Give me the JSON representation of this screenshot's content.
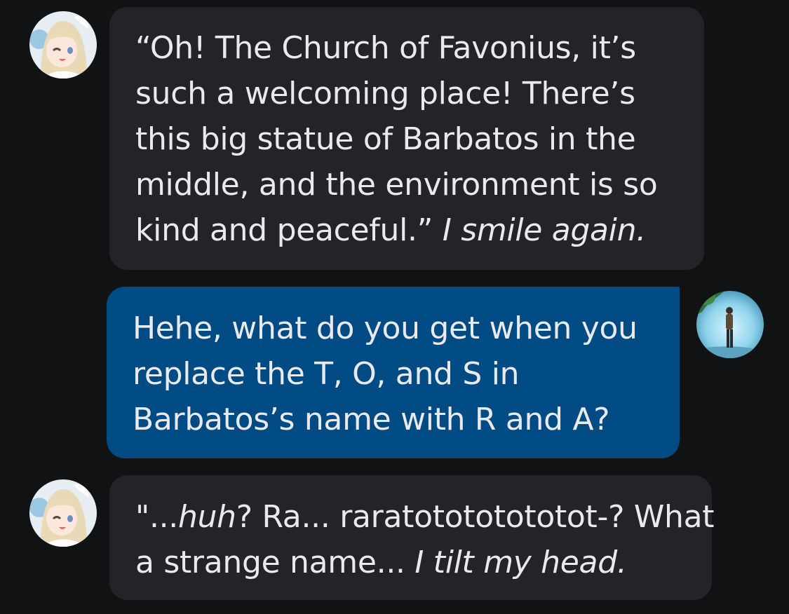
{
  "messages": [
    {
      "role": "character",
      "avatar": "character-avatar",
      "lines": [
        {
          "text": "“Oh! The Church of Favonius, it’s"
        },
        {
          "text": "such a welcoming place! There’s"
        },
        {
          "text": "this big statue of Barbatos in the"
        },
        {
          "text": "middle, and the environment is so"
        },
        {
          "text": "kind and peaceful.” ",
          "action": "I smile again."
        }
      ]
    },
    {
      "role": "user",
      "avatar": "user-avatar",
      "lines": [
        {
          "text": "Hehe, what do you get when you"
        },
        {
          "text": "replace the T, O, and S in"
        },
        {
          "text": "Barbatos’s name with R and A?"
        }
      ]
    },
    {
      "role": "character",
      "avatar": "character-avatar",
      "lines": [
        {
          "pre": "\"...",
          "emph": "huh",
          "text": "? Ra... raratotototototot-? What"
        },
        {
          "text": "a strange name... ",
          "action": "I tilt my head."
        }
      ]
    }
  ],
  "colors": {
    "background": "#111214",
    "character_bubble": "#222428",
    "user_bubble": "#004b83",
    "text": "#e9eaee"
  }
}
